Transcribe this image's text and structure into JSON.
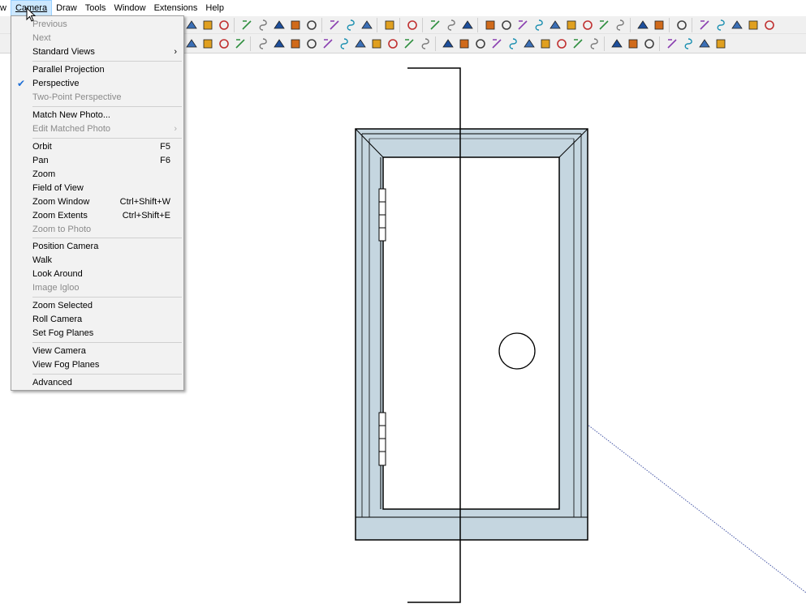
{
  "menubar": {
    "items": [
      "w",
      "Camera",
      "Draw",
      "Tools",
      "Window",
      "Extensions",
      "Help"
    ],
    "active": "Camera"
  },
  "camera_menu": {
    "items": [
      {
        "label": "Previous",
        "disabled": true
      },
      {
        "label": "Next",
        "disabled": true
      },
      {
        "label": "Standard Views",
        "submenu": true
      },
      {
        "label": "Parallel Projection"
      },
      {
        "label": "Perspective",
        "checked": true
      },
      {
        "label": "Two-Point Perspective",
        "disabled": true
      },
      {
        "label": "Match New Photo..."
      },
      {
        "label": "Edit Matched Photo",
        "disabled": true,
        "submenu": true
      },
      {
        "label": "Orbit",
        "shortcut": "F5"
      },
      {
        "label": "Pan",
        "shortcut": "F6"
      },
      {
        "label": "Zoom"
      },
      {
        "label": "Field of View"
      },
      {
        "label": "Zoom Window",
        "shortcut": "Ctrl+Shift+W"
      },
      {
        "label": "Zoom Extents",
        "shortcut": "Ctrl+Shift+E"
      },
      {
        "label": "Zoom to Photo",
        "disabled": true
      },
      {
        "label": "Position Camera"
      },
      {
        "label": "Walk"
      },
      {
        "label": "Look Around"
      },
      {
        "label": "Image Igloo",
        "disabled": true
      },
      {
        "label": "Zoom Selected"
      },
      {
        "label": "Roll Camera"
      },
      {
        "label": "Set Fog Planes"
      },
      {
        "label": "View Camera"
      },
      {
        "label": "View Fog Planes"
      },
      {
        "label": "Advanced"
      }
    ]
  },
  "toolbar_icons": {
    "row1": [
      "line-icon",
      "house-icon",
      "cube-front-icon",
      "cube-back-icon",
      "face-front-icon",
      "face-side-icon",
      "stack-icon",
      "box-blue-icon",
      "package-icon",
      "package-open-icon",
      "package-side-icon",
      "bridge-icon",
      "paint-frame-icon",
      "shield-icon",
      "lock-person-icon",
      "network-icon",
      "spiral-1-icon",
      "spiral-2-icon",
      "spiral-3-icon",
      "curve-1-icon",
      "spiral-4-icon",
      "spiral-5-icon",
      "spiral-6-icon",
      "curve-2-icon",
      "curve-3-icon",
      "target-icon",
      "pipe-icon",
      "undo-curve-icon",
      "mirror-icon",
      "blue-grid-icon",
      "yellow-db-icon",
      "film-icon",
      "blue-block-icon"
    ],
    "row2": [
      "circle-dashed-icon",
      "wrench-icon",
      "circle-red-icon",
      "circle-pink-icon",
      "line-tool-1-icon",
      "cross-line-icon",
      "square-line-icon",
      "pen-icon",
      "circle-slash-icon",
      "triangle-line-icon",
      "square-red-icon",
      "corner-icon",
      "arc-line-icon",
      "t-red-icon",
      "question-icon",
      "stack-1-icon",
      "stack-2-icon",
      "stack-3-icon",
      "stack-4-icon",
      "stack-5-icon",
      "stack-6-icon",
      "stack-7-icon",
      "stack-8-icon",
      "stack-9-icon",
      "stack-10-icon",
      "cube-move-icon",
      "cube-rotate-icon",
      "cube-scale-icon",
      "arrows-up-icon",
      "arrows-down-icon",
      "diagonal-icon",
      "split-icon"
    ]
  },
  "colors": {
    "menu_bg": "#f2f2f2",
    "menu_active": "#cce8ff",
    "frame_fill": "#c5d6e0",
    "frame_stroke": "#000000",
    "axis_blue": "#4a5aa8"
  }
}
